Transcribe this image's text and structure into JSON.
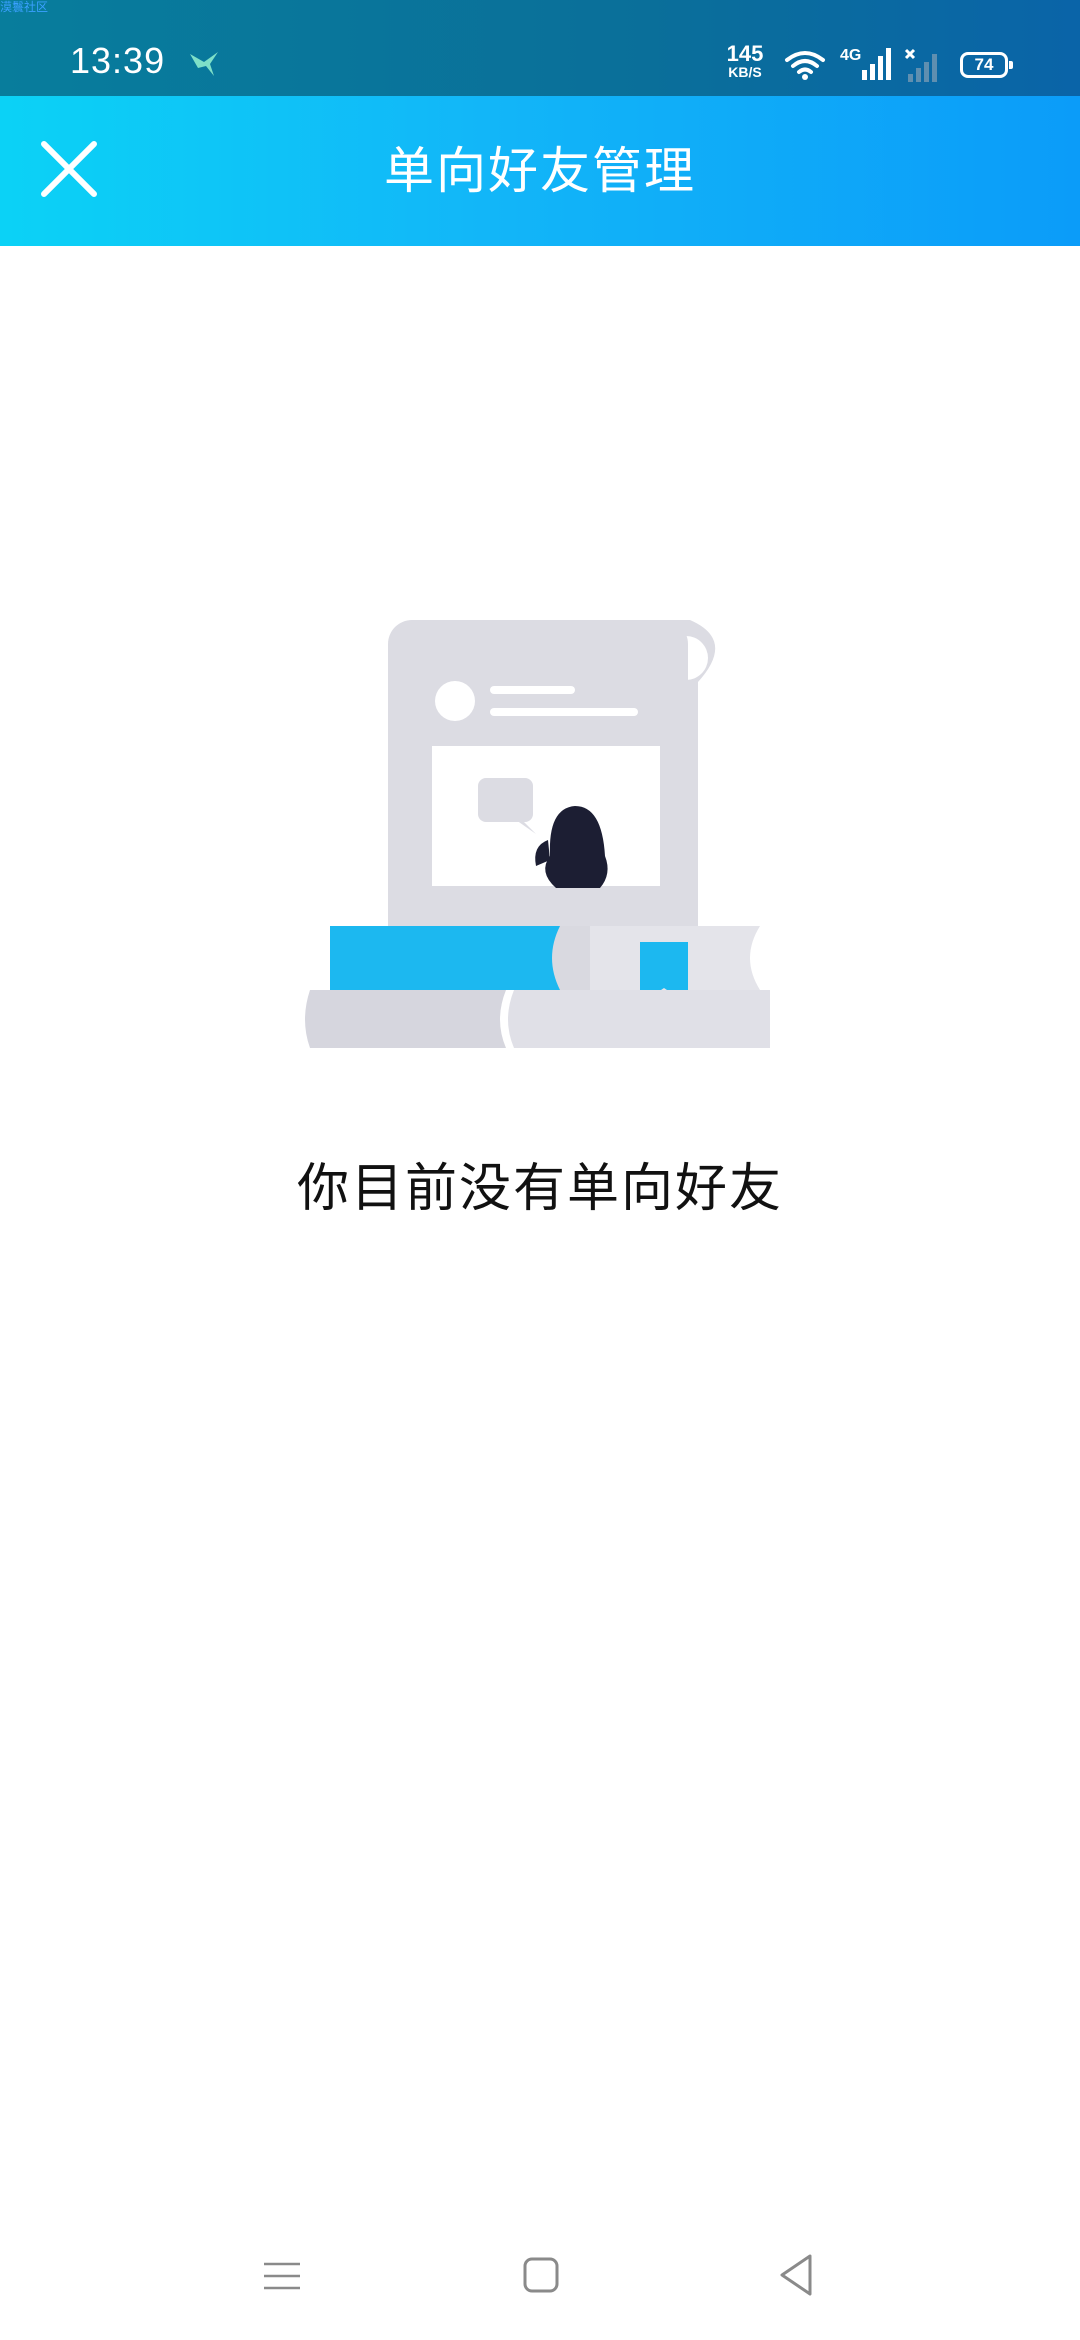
{
  "status_bar": {
    "watermark": "漠鬟社区",
    "time": "13:39",
    "speed_value": "145",
    "speed_unit": "KB/S",
    "network": "4G",
    "battery": "74"
  },
  "header": {
    "title": "单向好友管理",
    "close_icon": "close-icon"
  },
  "empty_state": {
    "message": "你目前没有单向好友",
    "illustration": "empty-scroll-books-penguin-illustration"
  },
  "navigation": {
    "menu_icon": "menu-icon",
    "home_icon": "home-icon",
    "back_icon": "back-icon"
  },
  "colors": {
    "header_gradient_start": "#0bd2f6",
    "header_gradient_end": "#0b9cf9",
    "accent_blue": "#1cb8f0"
  }
}
